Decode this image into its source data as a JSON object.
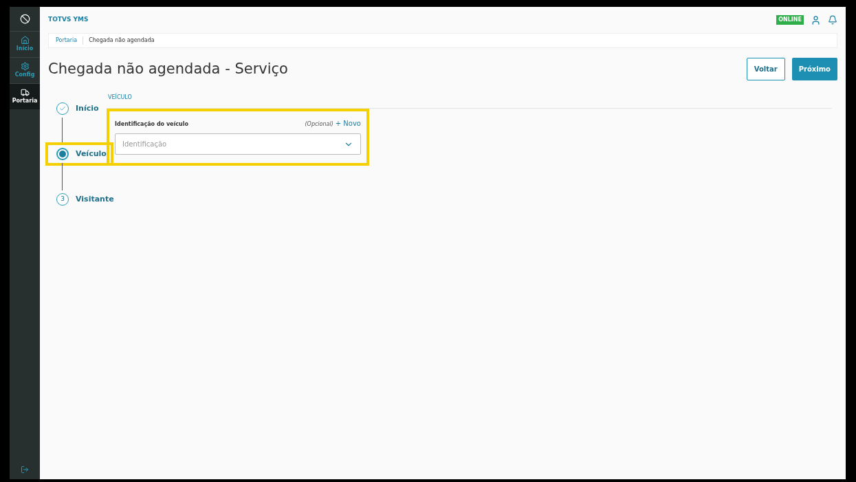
{
  "app": {
    "title": "TOTVS YMS",
    "status": "ONLINE"
  },
  "sidebar": {
    "items": [
      {
        "label": "Início",
        "selected": false
      },
      {
        "label": "Config",
        "selected": false
      },
      {
        "label": "Portaria",
        "selected": true
      }
    ]
  },
  "breadcrumb": [
    {
      "label": "Portaria",
      "kind": "link"
    },
    {
      "label": "Chegada não agendada",
      "kind": "current"
    }
  ],
  "page_title": "Chegada não agendada - Serviço",
  "buttons": [
    {
      "label": "Voltar",
      "kind": "secondary"
    },
    {
      "label": "Próximo",
      "kind": "primary"
    }
  ],
  "steps": [
    {
      "label": "Início",
      "kind": "done",
      "highlighted": false
    },
    {
      "label": "Veículo",
      "kind": "current",
      "highlighted": true
    },
    {
      "label": "Visitante",
      "marker": "3",
      "kind": "pending",
      "highlighted": false
    }
  ],
  "section": {
    "title": "VEÍCULO",
    "highlighted": true,
    "field": {
      "label": "Identificação do veículo",
      "optional": "(Opcional)",
      "new_link": "+ Novo",
      "placeholder": "Identificação"
    }
  }
}
